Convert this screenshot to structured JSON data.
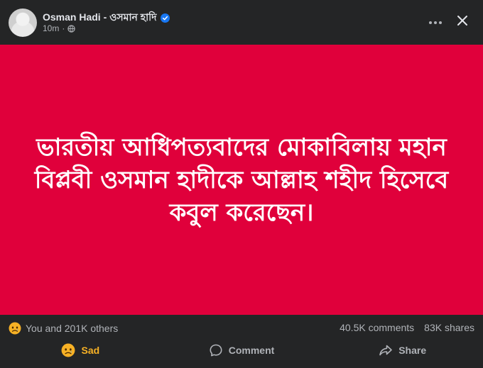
{
  "post": {
    "author": "Osman Hadi - ওসমান হাদি",
    "verified": true,
    "time": "10m",
    "separator": "·",
    "audience_icon": "globe-icon"
  },
  "header_actions": {
    "more_icon": "more-horizontal-icon",
    "close_icon": "close-icon"
  },
  "content": {
    "background": "#e0003b",
    "text": "ভারতীয় আধিপত্যবাদের মোকাবিলায় মহান বিপ্লবী ওসমান হাদীকে আল্লাহ শহীদ হিসেবে কবুল করেছেন।"
  },
  "stats": {
    "reaction_icon": "sad-emoji-icon",
    "reactions_text": "You and 201K others",
    "comments": "40.5K comments",
    "shares": "83K shares"
  },
  "actions": {
    "react_label": "Sad",
    "comment_label": "Comment",
    "share_label": "Share"
  },
  "colors": {
    "surface": "#242526",
    "text_primary": "#e4e6eb",
    "text_secondary": "#b0b3b8",
    "verified_blue": "#1877f2",
    "sad_yellow": "#f7b125"
  }
}
